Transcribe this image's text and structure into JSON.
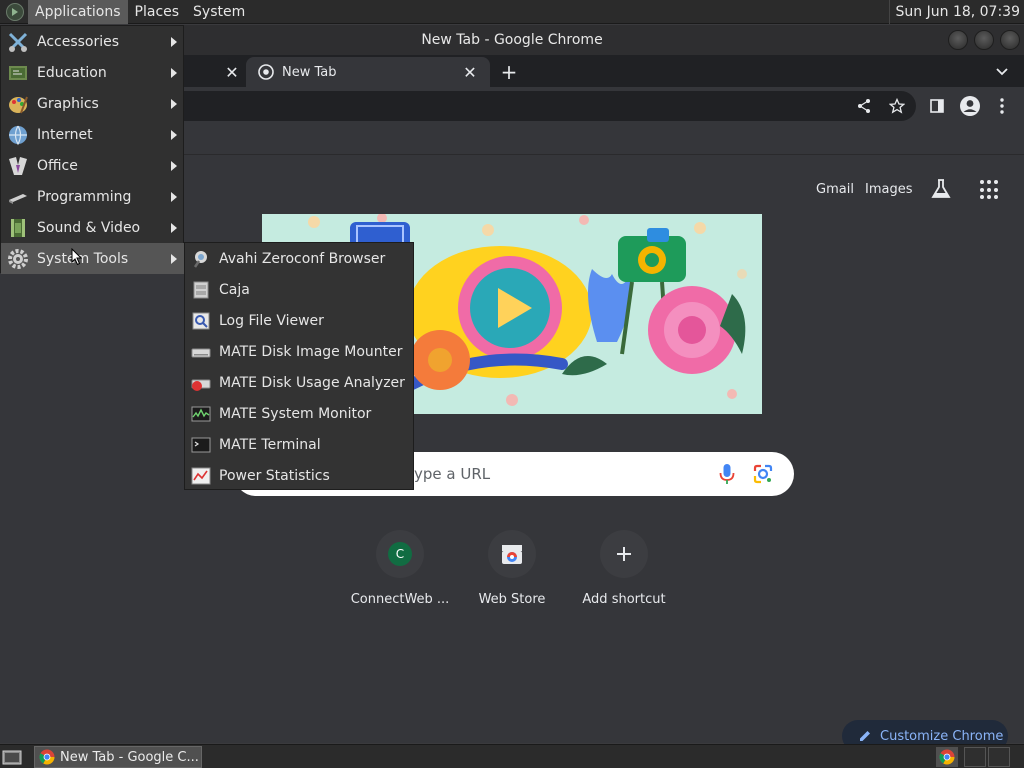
{
  "top_panel": {
    "menus": [
      {
        "label": "Applications",
        "active": true
      },
      {
        "label": "Places"
      },
      {
        "label": "System"
      }
    ],
    "clock": "Sun Jun 18, 07:39"
  },
  "window": {
    "title": "New Tab - Google Chrome",
    "tabs": [
      {
        "label": "",
        "active": false
      },
      {
        "label": "New Tab",
        "active": true
      }
    ]
  },
  "ntp": {
    "links": [
      "Gmail",
      "Images"
    ],
    "search_placeholder": "ype a URL",
    "shortcuts": [
      {
        "label": "ConnectWeb ...",
        "avatar": "C",
        "icon": "connectweb-icon"
      },
      {
        "label": "Web Store",
        "icon": "web-store-icon"
      },
      {
        "label": "Add shortcut",
        "icon": "plus-icon"
      }
    ],
    "customize_label": "Customize Chrome"
  },
  "app_menu": {
    "items": [
      {
        "label": "Accessories",
        "icon": "accessories-icon"
      },
      {
        "label": "Education",
        "icon": "education-icon"
      },
      {
        "label": "Graphics",
        "icon": "graphics-icon"
      },
      {
        "label": "Internet",
        "icon": "internet-icon"
      },
      {
        "label": "Office",
        "icon": "office-icon"
      },
      {
        "label": "Programming",
        "icon": "programming-icon"
      },
      {
        "label": "Sound & Video",
        "icon": "sound-video-icon"
      },
      {
        "label": "System Tools",
        "icon": "system-tools-icon",
        "hover": true
      }
    ],
    "system_tools": [
      {
        "label": "Avahi Zeroconf Browser",
        "icon": "avahi-icon"
      },
      {
        "label": "Caja",
        "icon": "caja-icon"
      },
      {
        "label": "Log File Viewer",
        "icon": "log-viewer-icon"
      },
      {
        "label": "MATE Disk Image Mounter",
        "icon": "disk-mounter-icon"
      },
      {
        "label": "MATE Disk Usage Analyzer",
        "icon": "disk-usage-icon"
      },
      {
        "label": "MATE System Monitor",
        "icon": "system-monitor-icon"
      },
      {
        "label": "MATE Terminal",
        "icon": "terminal-icon"
      },
      {
        "label": "Power Statistics",
        "icon": "power-stats-icon"
      }
    ]
  },
  "bottom_panel": {
    "task_label": "New Tab - Google C..."
  },
  "colors": {
    "panel": "#2b2b2b",
    "chrome_bg": "#35363a",
    "accent_blue": "#8ab4f8",
    "menu_hover": "#555555"
  }
}
